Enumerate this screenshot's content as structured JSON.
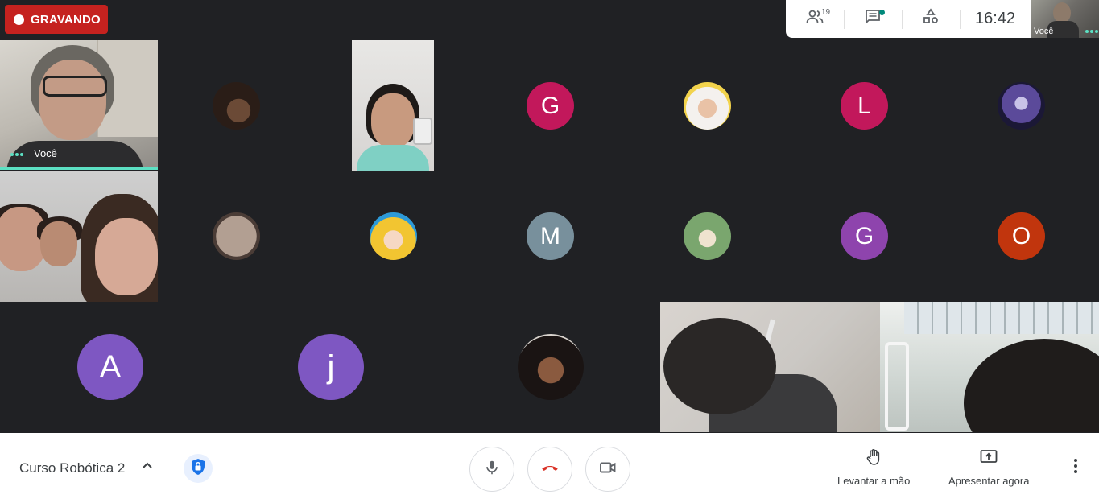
{
  "recording": {
    "label": "GRAVANDO",
    "color": "#c5221f"
  },
  "top_bar": {
    "people_count": "19",
    "clock": "16:42",
    "self_label": "Você"
  },
  "tiles": {
    "self": {
      "label": "Você"
    },
    "avatars": [
      {
        "letter": "G",
        "color": "#c2185b"
      },
      {
        "letter": "L",
        "color": "#c2185b"
      },
      {
        "letter": "M",
        "color": "#78909c"
      },
      {
        "letter": "G",
        "color": "#8e44ad"
      },
      {
        "letter": "O",
        "color": "#c1350d"
      },
      {
        "letter": "A",
        "color": "#7e57c2"
      },
      {
        "letter": "j",
        "color": "#7e57c2"
      }
    ]
  },
  "bottom_bar": {
    "meeting_title": "Curso Robótica 2",
    "raise_hand_label": "Levantar a mão",
    "present_label": "Apresentar agora"
  },
  "icons": {
    "people": "people-icon",
    "chat": "chat-icon",
    "activities": "activities-icon",
    "shield": "shield-lock-icon",
    "mic": "mic-icon",
    "hangup": "hangup-icon",
    "camera": "camera-icon",
    "hand": "hand-icon",
    "present": "present-icon",
    "more": "more-vert-icon"
  },
  "colors": {
    "speaking_indicator": "#5ce0c3",
    "background": "#202124"
  }
}
